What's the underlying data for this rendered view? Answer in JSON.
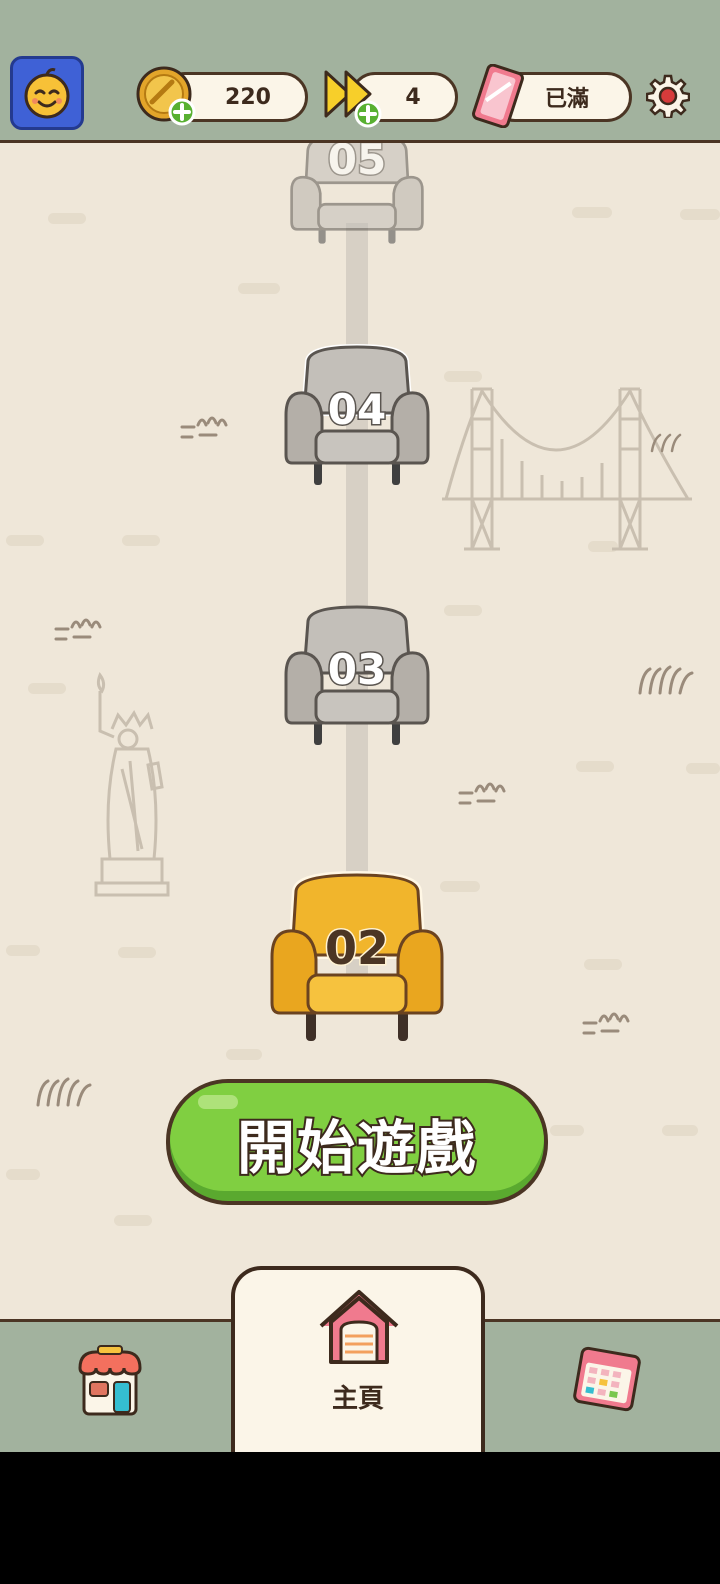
{
  "currency": {
    "coins": "220",
    "skips": "4",
    "tickets": "已滿"
  },
  "levels": [
    {
      "number": "05",
      "state": "locked"
    },
    {
      "number": "04",
      "state": "locked"
    },
    {
      "number": "03",
      "state": "locked"
    },
    {
      "number": "02",
      "state": "current"
    }
  ],
  "start_button": {
    "label": "開始遊戲"
  },
  "nav": {
    "shop": {
      "icon": "shop-icon"
    },
    "home": {
      "label": "主頁",
      "icon": "home-icon"
    },
    "calendar": {
      "icon": "calendar-icon"
    }
  },
  "colors": {
    "current_level": "#f1b52c",
    "locked_level": "#c3bfb9",
    "start_button": "#80cf41",
    "avatar_bg": "#3f61d6"
  }
}
